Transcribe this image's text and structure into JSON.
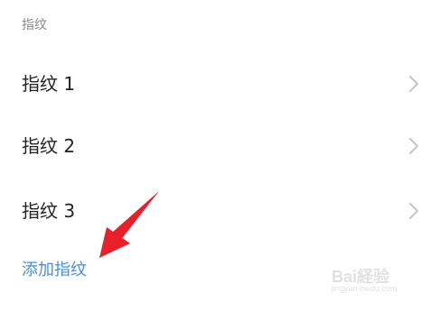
{
  "section": {
    "title": "指纹"
  },
  "fingerprints": [
    {
      "label": "指纹 1"
    },
    {
      "label": "指纹 2"
    },
    {
      "label": "指纹 3"
    }
  ],
  "actions": {
    "add_label": "添加指纹"
  },
  "overlay": {
    "arrow_color": "#e8202a",
    "watermark_text": "Bai経验",
    "watermark_sub": "jingyan.baidu.com"
  },
  "colors": {
    "link": "#4a8fd6",
    "chevron": "#c4c4c4"
  }
}
